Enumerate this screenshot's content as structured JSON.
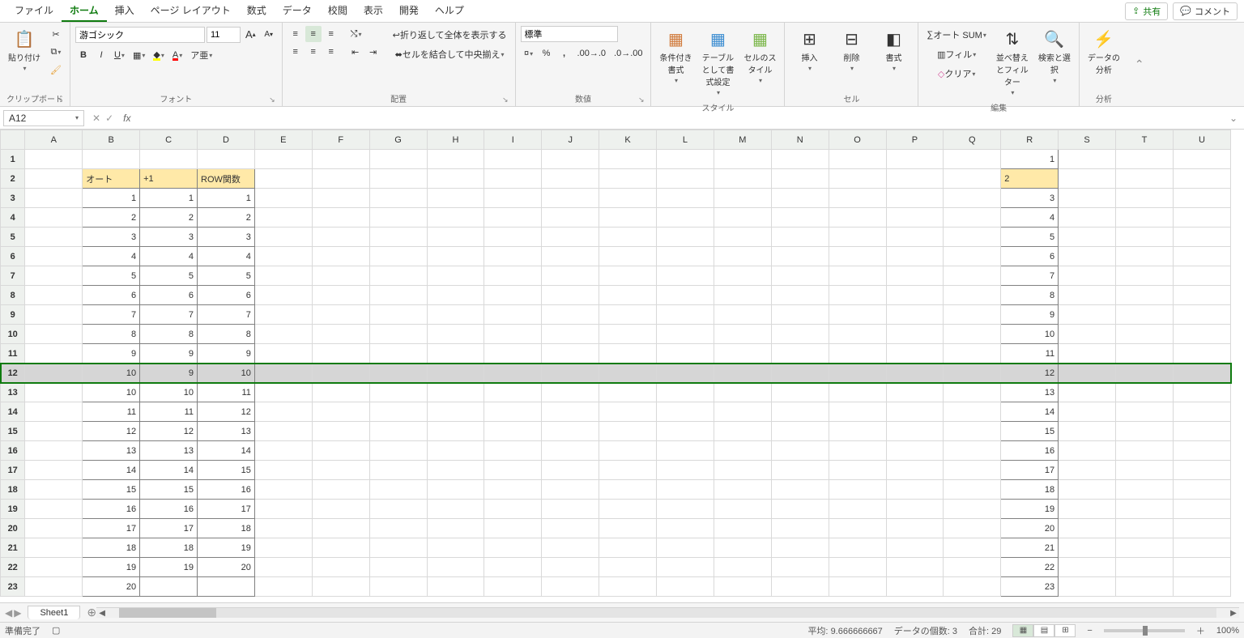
{
  "tabs": {
    "items": [
      "ファイル",
      "ホーム",
      "挿入",
      "ページ レイアウト",
      "数式",
      "データ",
      "校閲",
      "表示",
      "開発",
      "ヘルプ"
    ],
    "active_index": 1,
    "share": "共有",
    "comment": "コメント"
  },
  "ribbon": {
    "clipboard": {
      "label": "クリップボード",
      "paste": "貼り付け"
    },
    "font": {
      "label": "フォント",
      "name": "游ゴシック",
      "size": "11",
      "bold": "B",
      "italic": "I",
      "underline": "U",
      "grow": "A",
      "shrink": "A"
    },
    "align": {
      "label": "配置",
      "wrap": "折り返して全体を表示する",
      "merge": "セルを結合して中央揃え"
    },
    "number": {
      "label": "数値",
      "format": "標準",
      "percent": "%",
      "comma": ","
    },
    "styles": {
      "label": "スタイル",
      "cond": "条件付き書式",
      "table": "テーブルとして書式設定",
      "cell": "セルのスタイル"
    },
    "cells": {
      "label": "セル",
      "insert": "挿入",
      "delete": "削除",
      "format": "書式"
    },
    "editing": {
      "label": "編集",
      "autosum": "オート SUM",
      "fill": "フィル",
      "clear": "クリア",
      "sort": "並べ替えとフィルター",
      "find": "検索と選択"
    },
    "analysis": {
      "label": "分析",
      "analyze": "データの分析"
    }
  },
  "name_box": "A12",
  "formula": "",
  "columns": [
    "A",
    "B",
    "C",
    "D",
    "E",
    "F",
    "G",
    "H",
    "I",
    "J",
    "K",
    "L",
    "M",
    "N",
    "O",
    "P",
    "Q",
    "R",
    "S",
    "T",
    "U"
  ],
  "selected_row": 12,
  "headers": {
    "b": "オート",
    "c": "+1",
    "d": "ROW関数"
  },
  "rows": [
    {
      "r": 1
    },
    {
      "r": 2,
      "b": "オート",
      "c": "+1",
      "d": "ROW関数",
      "hdr": true
    },
    {
      "r": 3,
      "b": "1",
      "c": "1",
      "d": "1"
    },
    {
      "r": 4,
      "b": "2",
      "c": "2",
      "d": "2"
    },
    {
      "r": 5,
      "b": "3",
      "c": "3",
      "d": "3"
    },
    {
      "r": 6,
      "b": "4",
      "c": "4",
      "d": "4"
    },
    {
      "r": 7,
      "b": "5",
      "c": "5",
      "d": "5"
    },
    {
      "r": 8,
      "b": "6",
      "c": "6",
      "d": "6"
    },
    {
      "r": 9,
      "b": "7",
      "c": "7",
      "d": "7"
    },
    {
      "r": 10,
      "b": "8",
      "c": "8",
      "d": "8"
    },
    {
      "r": 11,
      "b": "9",
      "c": "9",
      "d": "9"
    },
    {
      "r": 12,
      "b": "10",
      "c": "9",
      "d": "10"
    },
    {
      "r": 13,
      "b": "10",
      "c": "10",
      "d": "11"
    },
    {
      "r": 14,
      "b": "11",
      "c": "11",
      "d": "12"
    },
    {
      "r": 15,
      "b": "12",
      "c": "12",
      "d": "13"
    },
    {
      "r": 16,
      "b": "13",
      "c": "13",
      "d": "14"
    },
    {
      "r": 17,
      "b": "14",
      "c": "14",
      "d": "15"
    },
    {
      "r": 18,
      "b": "15",
      "c": "15",
      "d": "16"
    },
    {
      "r": 19,
      "b": "16",
      "c": "16",
      "d": "17"
    },
    {
      "r": 20,
      "b": "17",
      "c": "17",
      "d": "18"
    },
    {
      "r": 21,
      "b": "18",
      "c": "18",
      "d": "19"
    },
    {
      "r": 22,
      "b": "19",
      "c": "19",
      "d": "20"
    },
    {
      "r": 23,
      "b": "20",
      "c": "",
      "d": ""
    }
  ],
  "sheet_tab": "Sheet1",
  "status": {
    "ready": "準備完了",
    "avg_label": "平均:",
    "avg": "9.666666667",
    "count_label": "データの個数:",
    "count": "3",
    "sum_label": "合計:",
    "sum": "29",
    "zoom": "100%"
  }
}
